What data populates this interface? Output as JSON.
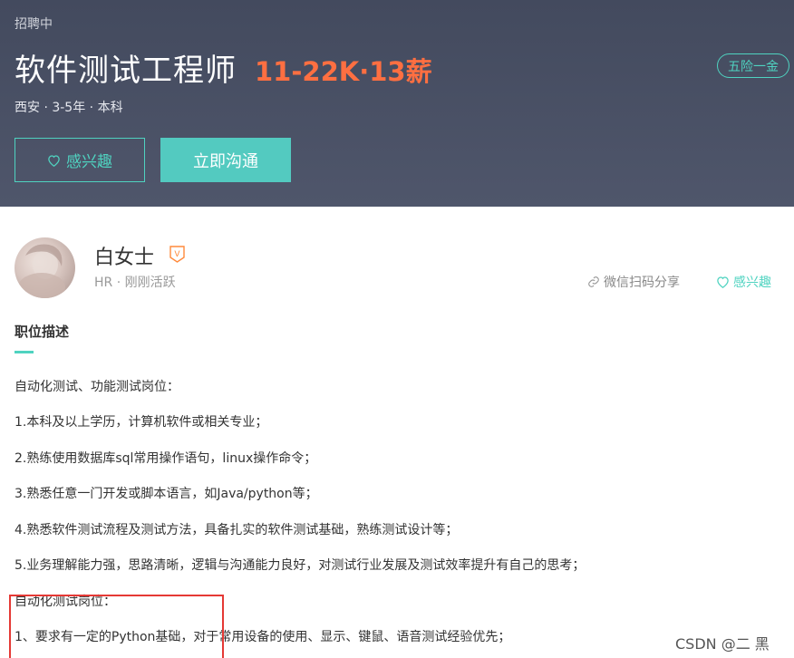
{
  "header": {
    "status": "招聘中",
    "job_title": "软件测试工程师",
    "salary": "11-22K·13薪",
    "benefit": "五险一金",
    "meta": "西安 · 3-5年 · 本科",
    "like_label": "感兴趣",
    "chat_label": "立即沟通"
  },
  "recruiter": {
    "name": "白女士",
    "badge": "V",
    "meta": "HR · 刚刚活跃",
    "share_label": "微信扫码分享",
    "like_label": "感兴趣"
  },
  "description": {
    "title": "职位描述",
    "lines": [
      "自动化测试、功能测试岗位：",
      "1.本科及以上学历，计算机软件或相关专业；",
      "2.熟练使用数据库sql常用操作语句，linux操作命令；",
      "3.熟悉任意一门开发或脚本语言，如Java/python等；",
      "4.熟悉软件测试流程及测试方法，具备扎实的软件测试基础，熟练测试设计等；",
      "5.业务理解能力强，思路清晰，逻辑与沟通能力良好，对测试行业发展及测试效率提升有自己的思考；",
      "自动化测试岗位：",
      "1、要求有一定的Python基础，对于常用设备的使用、显示、键鼠、语音测试经验优先；"
    ]
  },
  "watermark": "CSDN @二 黑",
  "colors": {
    "accent": "#4fd3c0",
    "salary": "#ff6f41",
    "header_bg": "#4a5064"
  }
}
